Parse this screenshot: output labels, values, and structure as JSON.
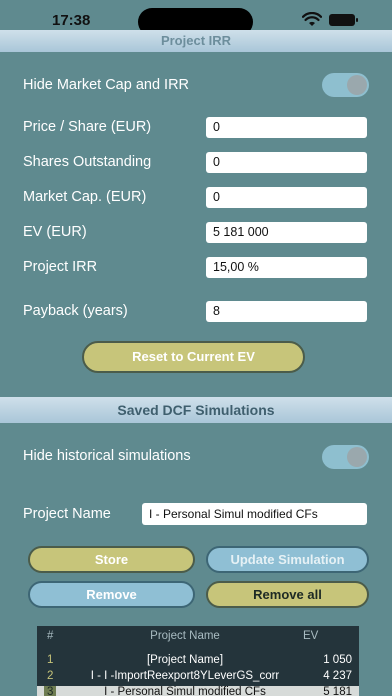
{
  "status": {
    "time": "17:38"
  },
  "project_irr": {
    "header": "Project IRR",
    "hide_market_cap_label": "Hide Market Cap and IRR",
    "hide_market_cap_on": true,
    "fields": [
      {
        "label": "Price / Share (EUR)",
        "value": "0"
      },
      {
        "label": "Shares Outstanding",
        "value": "0"
      },
      {
        "label": "Market Cap. (EUR)",
        "value": "0"
      },
      {
        "label": "EV (EUR)",
        "value": "5 181 000"
      },
      {
        "label": "Project IRR",
        "value": "15,00 %"
      },
      {
        "label": "Payback (years)",
        "value": "8"
      }
    ],
    "reset_button": "Reset to Current EV"
  },
  "saved_dcf": {
    "header": "Saved DCF Simulations",
    "hide_historical_label": "Hide historical simulations",
    "hide_historical_on": true,
    "project_name_label": "Project Name",
    "project_name_value": "I - Personal Simul modified CFs",
    "buttons": {
      "store": "Store",
      "update_simulation": "Update Simulation",
      "remove": "Remove",
      "remove_all": "Remove all"
    },
    "table": {
      "columns": [
        "#",
        "Project Name",
        "EV"
      ],
      "rows": [
        {
          "num": "1",
          "name": "[Project Name]",
          "ev": "1 050"
        },
        {
          "num": "2",
          "name": "I - I -ImportReexport8YLeverGS_corr",
          "ev": "4 237"
        },
        {
          "num": "3",
          "name": "I - Personal Simul modified CFs",
          "ev": "5 181"
        }
      ],
      "selected_row": 3
    }
  },
  "colors": {
    "background": "#5f8a8f",
    "header_band": "#bcd3e1",
    "button_yellow": "#c7c57a",
    "button_blue": "#8fbfd4",
    "table_bg": "#24343b"
  }
}
